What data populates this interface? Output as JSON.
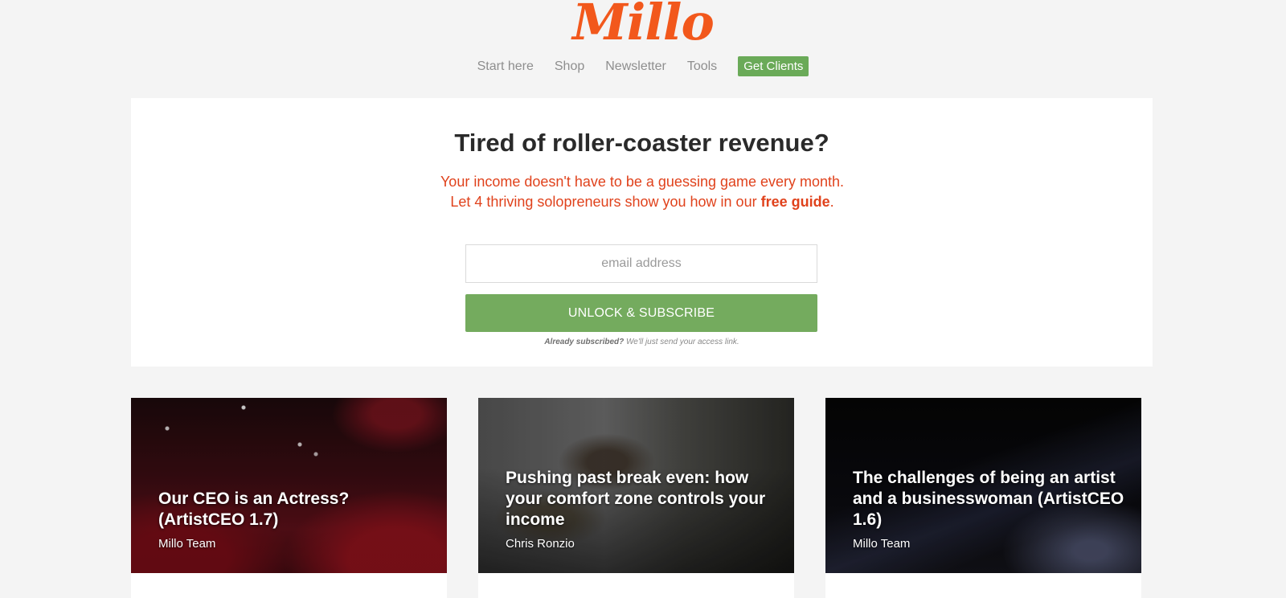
{
  "header": {
    "logo_text": "Millo",
    "nav": {
      "start_here": "Start here",
      "shop": "Shop",
      "newsletter": "Newsletter",
      "tools": "Tools",
      "get_clients": "Get Clients"
    }
  },
  "signup": {
    "title": "Tired of roller-coaster revenue?",
    "description_part1": "Your income doesn't have to be a guessing game every month. Let 4 thriving solopreneurs show you how in our ",
    "description_bold": "free guide",
    "description_part2": ".",
    "email_placeholder": "email address",
    "button_label": "UNLOCK & SUBSCRIBE",
    "already_bold": "Already subscribed?",
    "already_text": " We'll just send your access link."
  },
  "cards": [
    {
      "title": "Our CEO is an Actress? (ArtistCEO 1.7)",
      "author": "Millo Team"
    },
    {
      "title": "Pushing past break even: how your comfort zone controls your income",
      "author": "Chris Ronzio"
    },
    {
      "title": "The challenges of being an artist and a businesswoman (ArtistCEO 1.6)",
      "author": "Millo Team"
    }
  ],
  "colors": {
    "brand_orange": "#f2581c",
    "accent_green": "#74ab5e",
    "text_red": "#e0421c"
  }
}
